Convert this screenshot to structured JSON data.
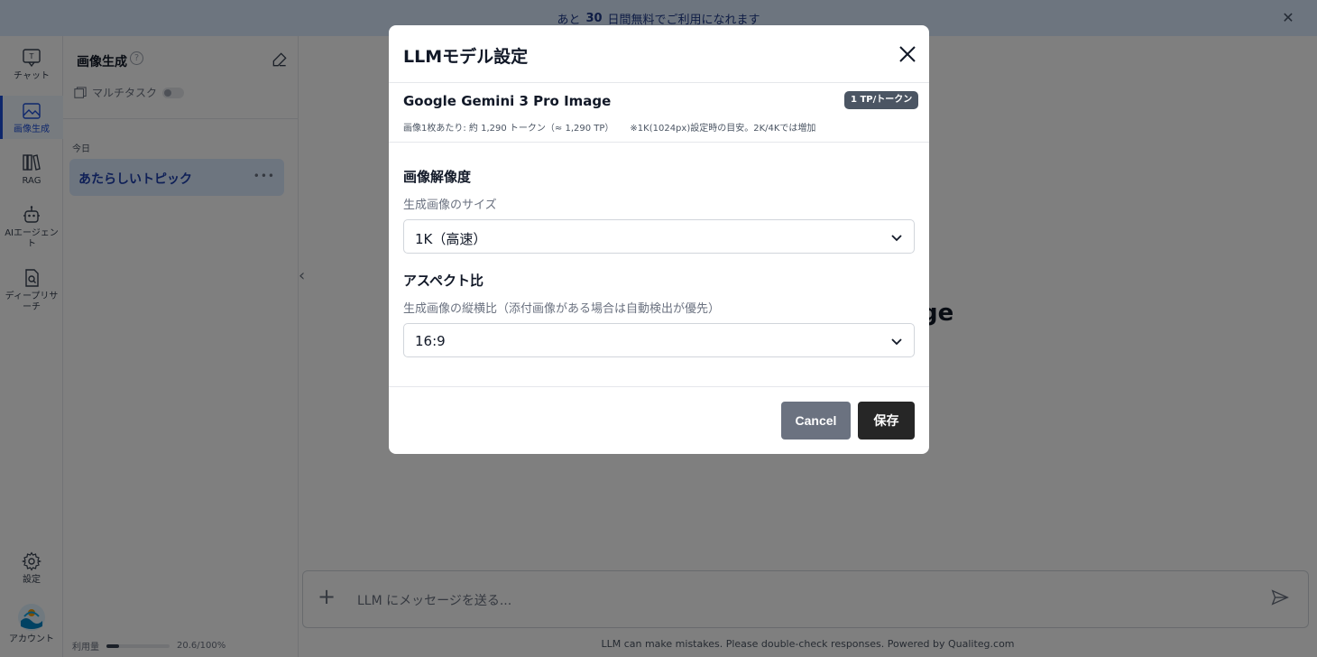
{
  "banner": {
    "prefix": "あと",
    "days": "30",
    "suffix": "日間無料でご利用になれます"
  },
  "rail": {
    "items": [
      {
        "label": "チャット",
        "icon": "chat-icon"
      },
      {
        "label": "画像生成",
        "icon": "image-icon"
      },
      {
        "label": "RAG",
        "icon": "books-icon"
      },
      {
        "label": "AIエージェント",
        "icon": "robot-icon"
      },
      {
        "label": "ディープリサーチ",
        "icon": "document-search-icon"
      }
    ],
    "settings_label": "設定",
    "account_label": "アカウント"
  },
  "sidebar": {
    "title": "画像生成",
    "help": "?",
    "multitask_label": "マルチタスク",
    "today_label": "今日",
    "topic_label": "あたらしいトピック",
    "topic_more": "•••",
    "usage_label": "利用量",
    "usage_value": "20.6/100%",
    "usage_fraction": 0.206
  },
  "main": {
    "heading_visible": "ge",
    "composer_placeholder": "LLM にメッセージを送る...",
    "footer": "LLM can make mistakes. Please double-check responses. Powered by Qualiteg.com"
  },
  "modal": {
    "title": "LLMモデル設定",
    "model_name": "Google Gemini 3 Pro Image",
    "badge": "1 TP/トークン",
    "note_tokens": "画像1枚あたり: 約 1,290 トークン（≈ 1,290 TP）",
    "note_hint": "※1K(1024px)設定時の目安。2K/4Kでは増加",
    "resolution_title": "画像解像度",
    "resolution_sub": "生成画像のサイズ",
    "resolution_value": "1K（高速）",
    "aspect_title": "アスペクト比",
    "aspect_sub": "生成画像の縦横比（添付画像がある場合は自動検出が優先）",
    "aspect_value": "16:9",
    "cancel_label": "Cancel",
    "save_label": "保存"
  },
  "colors": {
    "accent": "#1d4ed8",
    "save_button": "#262626",
    "cancel_button": "#6b7280",
    "banner": "#dbeafe"
  }
}
